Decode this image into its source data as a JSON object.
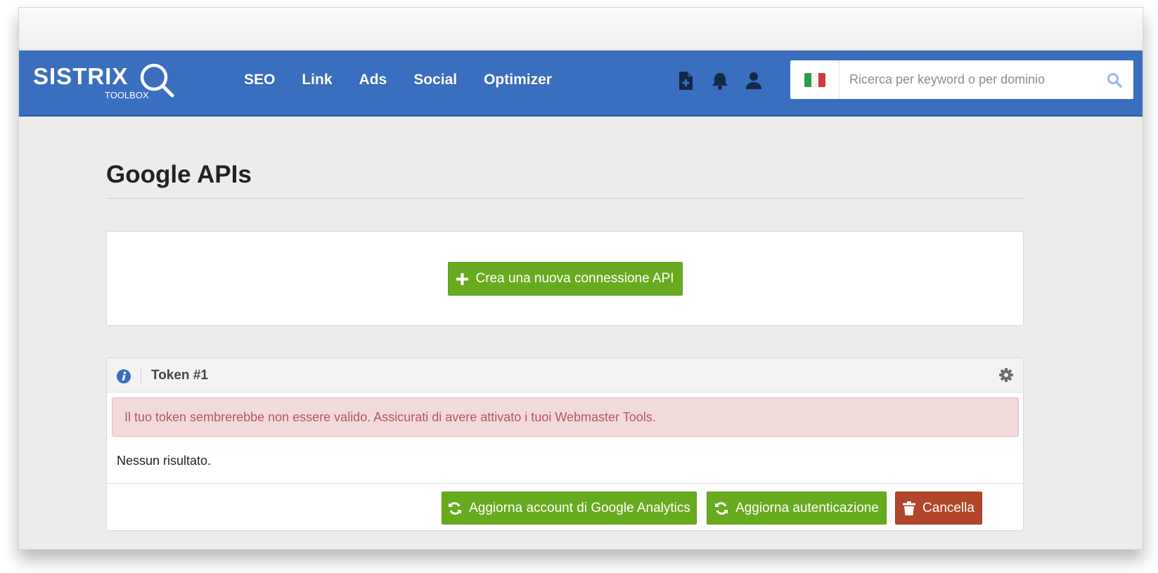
{
  "header": {
    "logo_text": "SISTRIX",
    "logo_sub": "TOOLBOX",
    "nav": [
      "SEO",
      "Link",
      "Ads",
      "Social",
      "Optimizer"
    ],
    "icons": [
      "file-add-icon",
      "bell-icon",
      "user-icon"
    ]
  },
  "search": {
    "placeholder": "Ricerca per keyword o per dominio",
    "country_flag": "italy-flag-icon"
  },
  "page": {
    "title": "Google APIs"
  },
  "create_panel": {
    "button_label": "Crea una nuova connessione API"
  },
  "token_panel": {
    "title": "Token #1",
    "alert": "Il tuo token sembrerebbe non essere valido. Assicurati di avere attivato i tuoi Webmaster Tools.",
    "empty_text": "Nessun risultato.",
    "buttons": {
      "refresh_ga": "Aggiorna account di Google Analytics",
      "refresh_auth": "Aggiorna autenticazione",
      "delete": "Cancella"
    }
  },
  "colors": {
    "brand_blue": "#3a6fbf",
    "green": "#67ab1f",
    "red": "#b2462a",
    "alert_bg": "#f2dadb",
    "alert_text": "#b5585a"
  }
}
